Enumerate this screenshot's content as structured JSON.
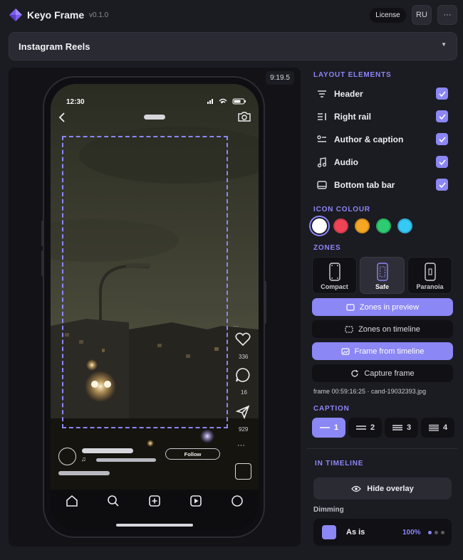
{
  "app": {
    "title": "Keyo Frame",
    "version": "v0.1.0",
    "license_label": "License",
    "lang_label": "RU",
    "menu_label": "···",
    "logo_icon": "diamond-logo-icon"
  },
  "preset": {
    "selected": "Instagram Reels"
  },
  "preview": {
    "timecode": "9:19.5",
    "status_time": "12:30",
    "counts": {
      "likes": "336",
      "comments": "16",
      "shares": "929"
    },
    "follow_label": "Follow",
    "overlay_more": "···"
  },
  "layout_elements": {
    "title": "LAYOUT ELEMENTS",
    "items": [
      {
        "label": "Header",
        "icon": "header-icon",
        "checked": true
      },
      {
        "label": "Right rail",
        "icon": "right-rail-icon",
        "checked": true
      },
      {
        "label": "Author & caption",
        "icon": "author-caption-icon",
        "checked": true
      },
      {
        "label": "Audio",
        "icon": "music-note-icon",
        "checked": true
      },
      {
        "label": "Bottom tab bar",
        "icon": "tab-bar-icon",
        "checked": true
      }
    ]
  },
  "icon_colour": {
    "title": "ICON COLOUR",
    "colors": [
      "#ffffff",
      "#ef4456",
      "#f5a623",
      "#2ecc71",
      "#36c9f5"
    ],
    "selected": "#ffffff"
  },
  "zones": {
    "title": "ZONES",
    "options": [
      {
        "label": "Compact",
        "active": false
      },
      {
        "label": "Safe",
        "active": true
      },
      {
        "label": "Paranoia",
        "active": false
      }
    ],
    "buttons": {
      "zones_in_preview": "Zones in preview",
      "zones_on_timeline": "Zones on timeline",
      "frame_from_timeline": "Frame from timeline",
      "capture_frame": "Capture frame"
    },
    "frame_info": "frame 00:59:16:25 · cand-19032393.jpg"
  },
  "caption": {
    "title": "CAPTION",
    "options": [
      "1",
      "2",
      "3",
      "4"
    ],
    "selected": "1"
  },
  "in_timeline": {
    "title": "IN TIMELINE",
    "hide_overlay": "Hide overlay",
    "dimming_label": "Dimming",
    "dimming_mode": "As is",
    "dimming_value": "100%"
  },
  "colors": {
    "accent": "#8b87f5",
    "background": "#1b1b22",
    "panel": "#101015"
  }
}
